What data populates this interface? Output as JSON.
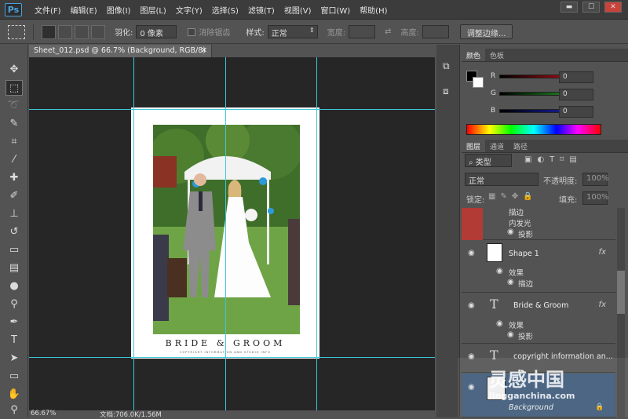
{
  "app": {
    "logo": "Ps"
  },
  "menu": [
    "文件(F)",
    "编辑(E)",
    "图像(I)",
    "图层(L)",
    "文字(Y)",
    "选择(S)",
    "滤镜(T)",
    "视图(V)",
    "窗口(W)",
    "帮助(H)"
  ],
  "window_buttons": [
    "▬",
    "☐",
    "✕"
  ],
  "options": {
    "feather_label": "羽化:",
    "feather_value": "0 像素",
    "antialias_label": "消除锯齿",
    "style_label": "样式:",
    "style_value": "正常",
    "width_label": "宽度:",
    "height_label": "高度:",
    "refine_button": "调整边缘..."
  },
  "document": {
    "tab_label": "Sheet_012.psd @ 66.7% (Background, RGB/8)",
    "close_glyph": "✕",
    "card_title": "BRIDE & GROOM",
    "card_copy": "COPYRIGHT INFORMATION AND STUDIO INFO"
  },
  "status": {
    "zoom": "66.67%",
    "doc": "文档:706.0K/1.56M"
  },
  "color_panel": {
    "tabs": [
      "颜色",
      "色板"
    ],
    "r_label": "R",
    "g_label": "G",
    "b_label": "B",
    "r_value": "0",
    "g_value": "0",
    "b_value": "0",
    "colors": {
      "red_bar": "#e0121b",
      "green_bar": "#23b22a",
      "blue_bar": "#1b29d6"
    }
  },
  "layers_panel": {
    "tabs": [
      "图层",
      "通道",
      "路径"
    ],
    "filter_kind": "类型",
    "blend_mode": "正常",
    "opacity_label": "不透明度:",
    "opacity_value": "100%",
    "lock_label": "锁定:",
    "fill_label": "填充:",
    "fill_value": "100%",
    "layers": [
      {
        "effects": [
          "描边",
          "内发光",
          "投影"
        ]
      },
      {
        "name": "Shape 1",
        "fx": "fx",
        "effects_label": "效果",
        "effects": [
          "描边"
        ]
      },
      {
        "name": "Bride & Groom",
        "fx": "fx",
        "effects_label": "效果",
        "effects": [
          "投影"
        ]
      },
      {
        "name": "copyright information an..."
      },
      {
        "name": "Background"
      }
    ]
  },
  "watermark": {
    "text": "灵感中国",
    "url": "lingganchina.com"
  }
}
